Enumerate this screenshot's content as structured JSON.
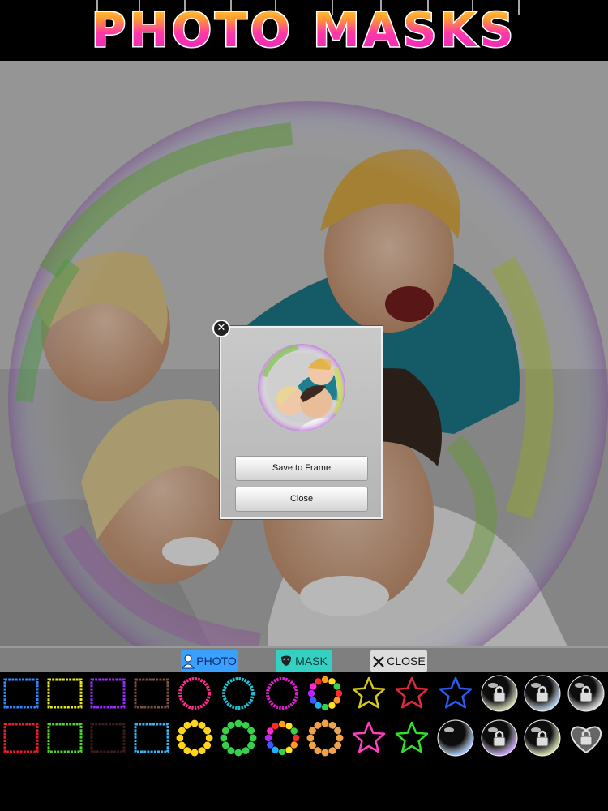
{
  "header": {
    "title": "PHOTO MASKS"
  },
  "dialog": {
    "save_label": "Save to Frame",
    "close_label": "Close",
    "close_icon": "close-x-icon"
  },
  "toolbar": {
    "photo_label": "PHOTO",
    "mask_label": "MASK",
    "close_label": "CLOSE",
    "photo_icon": "person-icon",
    "mask_icon": "theater-mask-icon",
    "close_icon": "x-icon"
  },
  "mask_grid": {
    "row1": [
      {
        "shape": "stamp-square",
        "color": "#2e8cff"
      },
      {
        "shape": "stamp-square",
        "color": "#e8e81c"
      },
      {
        "shape": "stamp-square",
        "color": "#9b2cff"
      },
      {
        "shape": "stamp-square",
        "color": "#7a5040"
      },
      {
        "shape": "stamp-ring",
        "color": "#ff2d8c"
      },
      {
        "shape": "stamp-ring",
        "color": "#1fc3d6"
      },
      {
        "shape": "stamp-ring",
        "color": "#e21fd0"
      },
      {
        "shape": "rainbow-ring",
        "color": "#ff5a1f"
      },
      {
        "shape": "star",
        "color": "#d9c81a"
      },
      {
        "shape": "star",
        "color": "#e02a3c"
      },
      {
        "shape": "star",
        "color": "#2a5cf0"
      },
      {
        "shape": "bubble-locked",
        "color": "#cfd8a0"
      },
      {
        "shape": "bubble-locked",
        "color": "#b0d0f0"
      },
      {
        "shape": "bubble-locked",
        "color": "#d8d8d8"
      }
    ],
    "row2": [
      {
        "shape": "stamp-square",
        "color": "#e81f2a"
      },
      {
        "shape": "stamp-square",
        "color": "#4fd22a"
      },
      {
        "shape": "stamp-square",
        "color": "#3a1d1d"
      },
      {
        "shape": "stamp-square",
        "color": "#38b6f0"
      },
      {
        "shape": "flower-ring",
        "color": "#ffd51c"
      },
      {
        "shape": "flower-ring",
        "color": "#37d04a"
      },
      {
        "shape": "rainbow-ring",
        "color": "#ff2a7a"
      },
      {
        "shape": "flower-ring",
        "color": "#f0a24a"
      },
      {
        "shape": "star",
        "color": "#ff3fbf"
      },
      {
        "shape": "star",
        "color": "#2fe02f"
      },
      {
        "shape": "bubble",
        "color": "#a0c8ff"
      },
      {
        "shape": "bubble-locked",
        "color": "#c8a0ff"
      },
      {
        "shape": "bubble-locked",
        "color": "#d0e0a0"
      },
      {
        "shape": "heart-locked",
        "color": "#d8d8d8"
      }
    ]
  }
}
